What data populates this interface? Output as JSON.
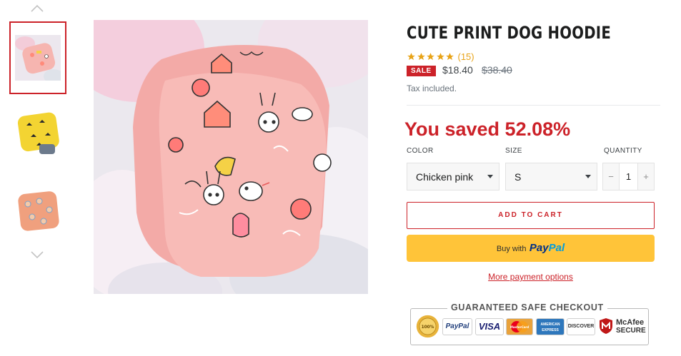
{
  "product": {
    "title": "CUTE PRINT DOG HOODIE",
    "rating": 5,
    "reviews": "(15)",
    "sale_badge": "SALE",
    "price": "$18.40",
    "compare_price": "$38.40",
    "tax_note": "Tax included.",
    "saved_text": "You saved 52.08%"
  },
  "options": {
    "color_label": "COLOR",
    "color_value": "Chicken pink",
    "size_label": "SIZE",
    "size_value": "S",
    "quantity_label": "QUANTITY",
    "quantity_value": "1",
    "minus": "−",
    "plus": "+"
  },
  "actions": {
    "add_to_cart": "ADD TO CART",
    "buy_with": "Buy with",
    "paypal_pay": "Pay",
    "paypal_pal": "Pal",
    "more_payment": "More payment options"
  },
  "checkout": {
    "title": "GUARANTEED SAFE CHECKOUT",
    "logos": {
      "paypal": "PayPal",
      "visa": "VISA",
      "mastercard": "MasterCard",
      "amex": "AMERICAN EXPRESS",
      "discover": "DISCOVER",
      "mcafee_1": "McAfee",
      "mcafee_2": "SECURE"
    }
  },
  "gallery": {
    "thumbnails": [
      "pink hoodie",
      "yellow hoodie",
      "orange hoodie"
    ],
    "selected_index": 0
  },
  "colors": {
    "accent": "#cc2229",
    "star": "#e8a317",
    "paypal_button": "#ffc439"
  }
}
